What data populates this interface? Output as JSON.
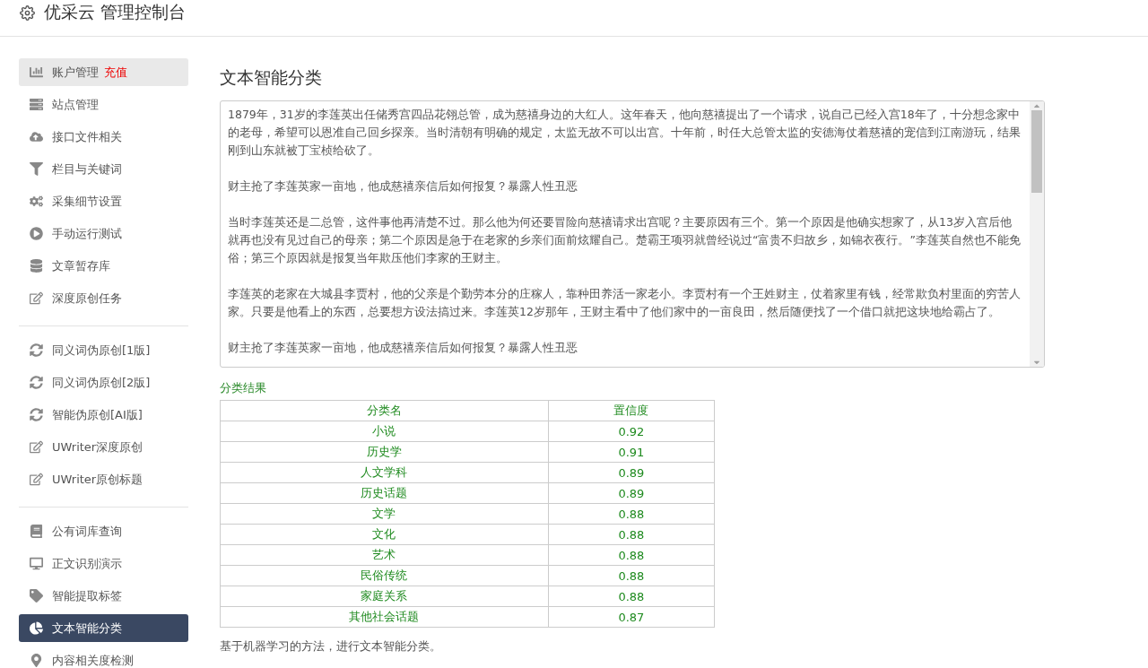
{
  "header": {
    "title": "优采云 管理控制台"
  },
  "sidebar": {
    "groups": [
      {
        "items": [
          {
            "label": "账户管理",
            "badge": "充值",
            "highlighted": true,
            "selected": false
          },
          {
            "label": "站点管理",
            "highlighted": false,
            "selected": false
          },
          {
            "label": "接口文件相关",
            "highlighted": false,
            "selected": false
          },
          {
            "label": "栏目与关键词",
            "highlighted": false,
            "selected": false
          },
          {
            "label": "采集细节设置",
            "highlighted": false,
            "selected": false
          },
          {
            "label": "手动运行测试",
            "highlighted": false,
            "selected": false
          },
          {
            "label": "文章暂存库",
            "highlighted": false,
            "selected": false
          },
          {
            "label": "深度原创任务",
            "highlighted": false,
            "selected": false
          }
        ]
      },
      {
        "items": [
          {
            "label": "同义词伪原创[1版]",
            "highlighted": false,
            "selected": false
          },
          {
            "label": "同义词伪原创[2版]",
            "highlighted": false,
            "selected": false
          },
          {
            "label": "智能伪原创[AI版]",
            "highlighted": false,
            "selected": false
          },
          {
            "label": "UWriter深度原创",
            "highlighted": false,
            "selected": false
          },
          {
            "label": "UWriter原创标题",
            "highlighted": false,
            "selected": false
          }
        ]
      },
      {
        "items": [
          {
            "label": "公有词库查询",
            "highlighted": false,
            "selected": false
          },
          {
            "label": "正文识别演示",
            "highlighted": false,
            "selected": false
          },
          {
            "label": "智能提取标签",
            "highlighted": false,
            "selected": false
          },
          {
            "label": "文本智能分类",
            "highlighted": false,
            "selected": true
          },
          {
            "label": "内容相关度检测",
            "highlighted": false,
            "selected": false
          }
        ]
      }
    ]
  },
  "main": {
    "title": "文本智能分类",
    "text_area": {
      "paragraphs": [
        "1879年，31岁的李莲英出任储秀宫四品花翎总管，成为慈禧身边的大红人。这年春天，他向慈禧提出了一个请求，说自己已经入宫18年了，十分想念家中的老母，希望可以恩准自己回乡探亲。当时清朝有明确的规定，太监无故不可以出宫。十年前，时任大总管太监的安德海仗着慈禧的宠信到江南游玩，结果刚到山东就被丁宝桢给砍了。",
        "财主抢了李莲英家一亩地，他成慈禧亲信后如何报复？暴露人性丑恶",
        "当时李莲英还是二总管，这件事他再清楚不过。那么他为何还要冒险向慈禧请求出宫呢？主要原因有三个。第一个原因是他确实想家了，从13岁入宫后他就再也没有见过自己的母亲；第二个原因是急于在老家的乡亲们面前炫耀自己。楚霸王项羽就曾经说过“富贵不归故乡，如锦衣夜行。”李莲英自然也不能免俗；第三个原因就是报复当年欺压他们李家的王财主。",
        "李莲英的老家在大城县李贾村，他的父亲是个勤劳本分的庄稼人，靠种田养活一家老小。李贾村有一个王姓财主，仗着家里有钱，经常欺负村里面的穷苦人家。只要是他看上的东西，总要想方设法搞过来。李莲英12岁那年，王财主看中了他们家中的一亩良田，然后随便找了一个借口就把这块地给霸占了。",
        "财主抢了李莲英家一亩地，他成慈禧亲信后如何报复？暴露人性丑恶"
      ]
    },
    "result_label": "分类结果",
    "table": {
      "columns": [
        "分类名",
        "置信度"
      ],
      "rows": [
        [
          "小说",
          "0.92"
        ],
        [
          "历史学",
          "0.91"
        ],
        [
          "人文学科",
          "0.89"
        ],
        [
          "历史话题",
          "0.89"
        ],
        [
          "文学",
          "0.88"
        ],
        [
          "文化",
          "0.88"
        ],
        [
          "艺术",
          "0.88"
        ],
        [
          "民俗传统",
          "0.88"
        ],
        [
          "家庭关系",
          "0.88"
        ],
        [
          "其他社会话题",
          "0.87"
        ]
      ]
    },
    "note": "基于机器学习的方法，进行文本智能分类。"
  }
}
